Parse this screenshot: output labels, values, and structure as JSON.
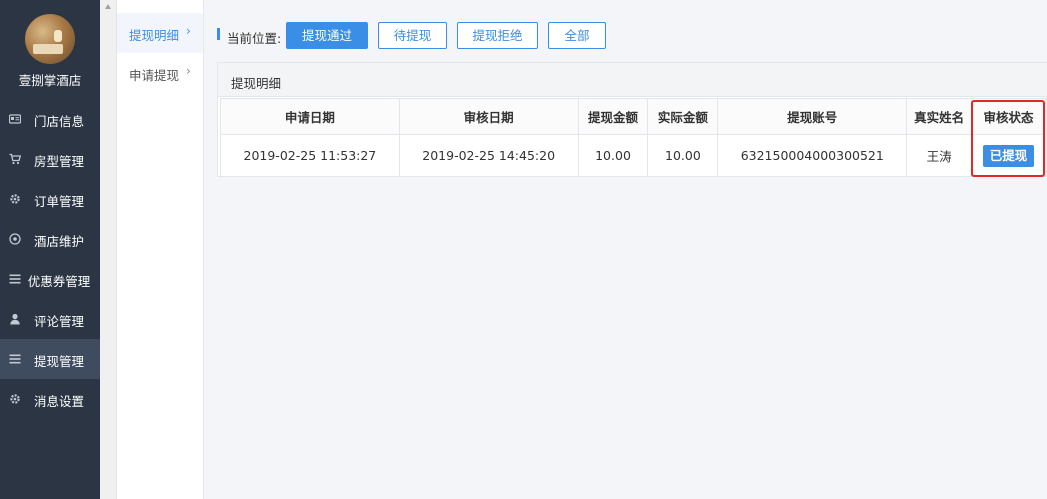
{
  "sidebar": {
    "hotel_name": "壹捌掌酒店",
    "items": [
      {
        "label": "门店信息",
        "icon": "id-card-icon"
      },
      {
        "label": "房型管理",
        "icon": "cart-icon"
      },
      {
        "label": "订单管理",
        "icon": "gear-icon"
      },
      {
        "label": "酒店维护",
        "icon": "compass-icon"
      },
      {
        "label": "优惠券管理",
        "icon": "list-icon"
      },
      {
        "label": "评论管理",
        "icon": "user-icon"
      },
      {
        "label": "提现管理",
        "icon": "list-icon",
        "active": true
      },
      {
        "label": "消息设置",
        "icon": "gear-icon"
      }
    ]
  },
  "submenu": {
    "items": [
      {
        "label": "提现明细",
        "active": true
      },
      {
        "label": "申请提现"
      }
    ],
    "chevron": "›"
  },
  "breadcrumb": {
    "label": "当前位置:"
  },
  "filters": [
    {
      "label": "提现通过",
      "active": true
    },
    {
      "label": "待提现"
    },
    {
      "label": "提现拒绝"
    },
    {
      "label": "全部"
    }
  ],
  "panel": {
    "title": "提现明细"
  },
  "table": {
    "columns": [
      "申请日期",
      "审核日期",
      "提现金额",
      "实际金额",
      "提现账号",
      "真实姓名",
      "审核状态"
    ],
    "rows": [
      {
        "apply_date": "2019-02-25 11:53:27",
        "review_date": "2019-02-25 14:45:20",
        "amount": "10.00",
        "actual_amount": "10.00",
        "account": "632150004000300521",
        "name": "王涛",
        "status": "已提现"
      }
    ]
  },
  "colors": {
    "sidebar_bg": "#2b3543",
    "sidebar_active": "#3f4b5e",
    "accent": "#3a8ee6",
    "highlight": "#e02a24"
  }
}
